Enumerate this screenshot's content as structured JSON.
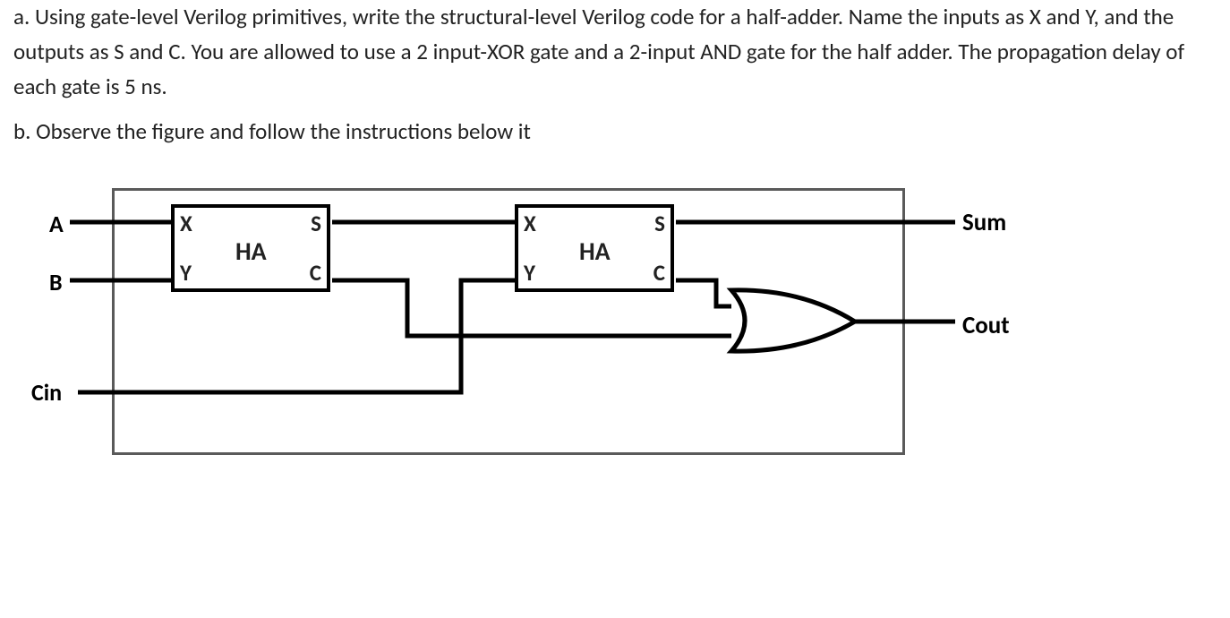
{
  "paragraph_a": "a. Using gate-level Verilog primitives, write the structural-level Verilog code for a half-adder. Name the inputs as X and Y, and the outputs as S and C. You are allowed to use a 2 input-XOR gate and a 2-input AND gate for the half adder. The propagation delay of each gate is 5 ns.",
  "paragraph_b": "b. Observe the figure and follow the instructions below it",
  "diagram": {
    "inputs": {
      "a": "A",
      "b": "B",
      "cin": "Cin"
    },
    "outputs": {
      "sum": "Sum",
      "cout": "Cout"
    },
    "ha1": {
      "name": "HA",
      "ports": {
        "x": "X",
        "y": "Y",
        "s": "S",
        "c": "C"
      }
    },
    "ha2": {
      "name": "HA",
      "ports": {
        "x": "X",
        "y": "Y",
        "s": "S",
        "c": "C"
      }
    }
  }
}
